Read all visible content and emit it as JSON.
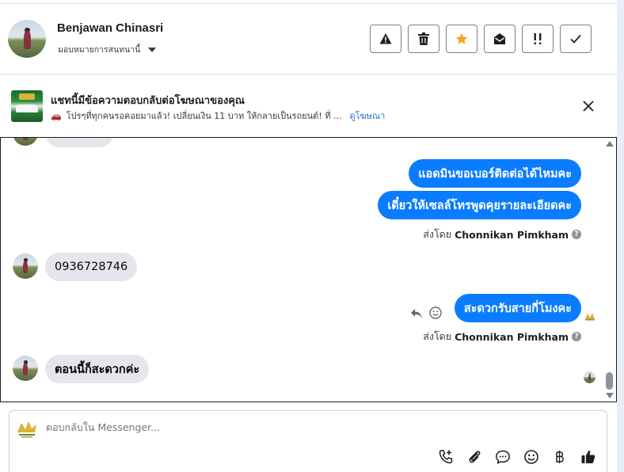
{
  "header": {
    "contact_name": "Benjawan Chinasri",
    "assign_label": "มอบหมายการสนทนานี้",
    "actions": [
      {
        "name": "mark-spam",
        "icon": "warning-icon"
      },
      {
        "name": "delete",
        "icon": "trash-icon"
      },
      {
        "name": "star",
        "icon": "star-icon",
        "color": "#f5a623"
      },
      {
        "name": "mark-unread",
        "icon": "envelope-open-icon"
      },
      {
        "name": "follow-up",
        "icon": "double-exclamation-icon"
      },
      {
        "name": "mark-done",
        "icon": "check-icon"
      }
    ]
  },
  "ad_banner": {
    "title": "แชทนี้มีข้อความตอบกลับต่อโฆษณาของคุณ",
    "subtitle": "โปรๆที่ทุกคนรอคอยมาแล้ว! เปลี่ยนเงิน 11 บาท ให้กลายเป็นรถยนต์! ที่ ...",
    "link": "ดูโฆษณา",
    "car_emoji": "🚗"
  },
  "thread": {
    "messages": [
      {
        "direction": "out",
        "text": "แอดมินขอเบอร์ติดต่อได้ไหมคะ"
      },
      {
        "direction": "out",
        "text": "เดี๋ยวให้เซลล์โทรพูดคุยรายละเอียดคะ"
      },
      {
        "direction": "in",
        "text": "0936728746"
      },
      {
        "direction": "out",
        "text": "สะดวกรับสายกี่โมงคะ"
      },
      {
        "direction": "in",
        "text": "ตอนนี้ก็สะดวกค่ะ"
      }
    ],
    "sent_by_prefix": "ส่งโดย",
    "sent_by_name": "Chonnikan Pimkham"
  },
  "composer": {
    "placeholder": "ตอบกลับใน Messenger...",
    "icons": [
      "phone-plus-icon",
      "paperclip-icon",
      "chat-bubble-icon",
      "emoji-icon",
      "baht-icon",
      "thumbs-up-icon"
    ]
  },
  "colors": {
    "accent": "#0a7cff",
    "link": "#216fdb",
    "incoming_bubble": "#e4e6eb",
    "star": "#f5a623"
  }
}
